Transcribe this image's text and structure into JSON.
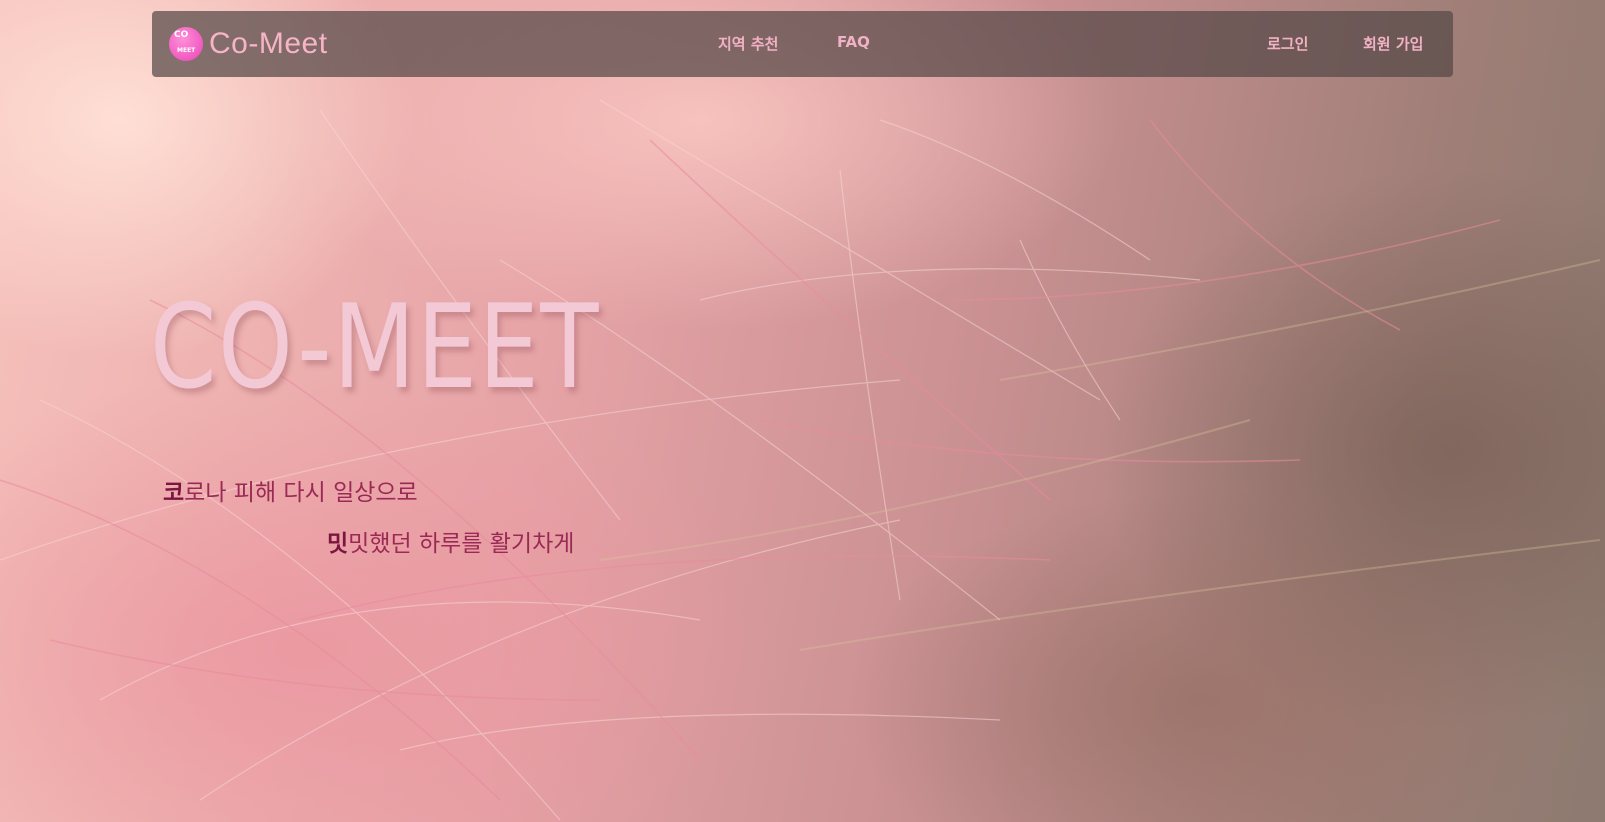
{
  "navbar": {
    "logo_badge_line1": "CO",
    "logo_badge_line2": "MEET",
    "brand": "Co-Meet",
    "links": [
      "지역 추천",
      "FAQ"
    ],
    "login": "로그인",
    "signup": "회원 가입"
  },
  "hero": {
    "title": "CO-MEET",
    "line1_lead": "코",
    "line1_rest": "로나 피해 다시 일상으로",
    "line2_lead": "밋",
    "line2_rest": "밋했던 하루를 활기차게"
  },
  "colors": {
    "accent": "#f2b2c6",
    "brand_pink": "#ea44b6",
    "tagline": "#9a2a55"
  }
}
